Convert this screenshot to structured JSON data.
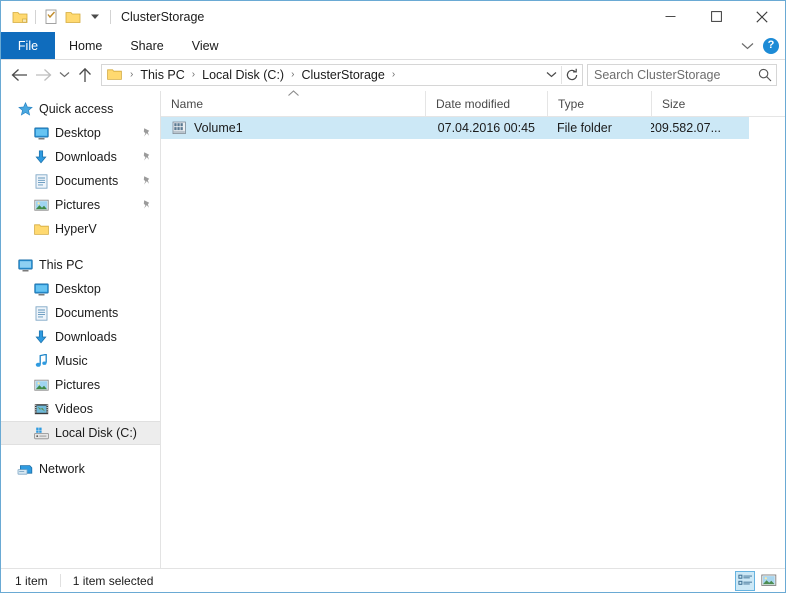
{
  "window": {
    "title": "ClusterStorage",
    "quick_access_toolbar": [
      {
        "name": "properties-folder-icon",
        "label": "Folder"
      },
      {
        "name": "properties-icon",
        "label": "Properties"
      },
      {
        "name": "new-folder-icon",
        "label": "New folder"
      },
      {
        "name": "customize-qat-chevron-icon",
        "label": "Customize Quick Access Toolbar"
      }
    ],
    "controls": {
      "minimize": "Minimize",
      "maximize": "Maximize",
      "close": "Close"
    }
  },
  "ribbon": {
    "tabs": [
      {
        "label": "File",
        "active": true
      },
      {
        "label": "Home",
        "active": false
      },
      {
        "label": "Share",
        "active": false
      },
      {
        "label": "View",
        "active": false
      }
    ],
    "expand_label": "Expand the Ribbon",
    "help_label": "?"
  },
  "address_bar": {
    "back": "Back",
    "forward": "Forward",
    "recent": "Recent locations",
    "up": "Up",
    "breadcrumbs": [
      "This PC",
      "Local Disk (C:)",
      "ClusterStorage"
    ],
    "separator": "›",
    "dropdown": "Previous locations",
    "refresh": "Refresh",
    "search_placeholder": "Search ClusterStorage",
    "search_value": ""
  },
  "sidebar": {
    "groups": [
      {
        "header": {
          "label": "Quick access",
          "icon": "quick-access-star-icon",
          "level": 0,
          "pinned": false
        },
        "items": [
          {
            "label": "Desktop",
            "icon": "desktop-icon",
            "level": 1,
            "pinned": true
          },
          {
            "label": "Downloads",
            "icon": "downloads-icon",
            "level": 1,
            "pinned": true
          },
          {
            "label": "Documents",
            "icon": "documents-icon",
            "level": 1,
            "pinned": true
          },
          {
            "label": "Pictures",
            "icon": "pictures-icon",
            "level": 1,
            "pinned": true
          },
          {
            "label": "HyperV",
            "icon": "folder-icon",
            "level": 1,
            "pinned": false
          }
        ]
      },
      {
        "header": {
          "label": "This PC",
          "icon": "this-pc-icon",
          "level": 0,
          "pinned": false
        },
        "items": [
          {
            "label": "Desktop",
            "icon": "desktop-icon",
            "level": 1,
            "pinned": false
          },
          {
            "label": "Documents",
            "icon": "documents-icon",
            "level": 1,
            "pinned": false
          },
          {
            "label": "Downloads",
            "icon": "downloads-icon",
            "level": 1,
            "pinned": false
          },
          {
            "label": "Music",
            "icon": "music-icon",
            "level": 1,
            "pinned": false
          },
          {
            "label": "Pictures",
            "icon": "pictures-icon",
            "level": 1,
            "pinned": false
          },
          {
            "label": "Videos",
            "icon": "videos-icon",
            "level": 1,
            "pinned": false
          },
          {
            "label": "Local Disk (C:)",
            "icon": "local-disk-icon",
            "level": 1,
            "pinned": false,
            "selected": true
          }
        ]
      },
      {
        "header": {
          "label": "Network",
          "icon": "network-icon",
          "level": 0,
          "pinned": false
        },
        "items": []
      }
    ]
  },
  "file_list": {
    "columns": [
      {
        "label": "Name",
        "sorted": "asc"
      },
      {
        "label": "Date modified",
        "sorted": ""
      },
      {
        "label": "Type",
        "sorted": ""
      },
      {
        "label": "Size",
        "sorted": ""
      }
    ],
    "rows": [
      {
        "name": "Volume1",
        "date_modified": "07.04.2016 00:45",
        "type": "File folder",
        "size": "209.582.07...",
        "icon": "mounted-volume-icon",
        "selected": true
      }
    ]
  },
  "status_bar": {
    "item_count": "1 item",
    "selection": "1 item selected",
    "views": [
      {
        "name": "details-view-button",
        "label": "Details view",
        "active": true
      },
      {
        "name": "large-icons-view-button",
        "label": "Large icons view",
        "active": false
      }
    ]
  },
  "colors": {
    "accent": "#0f6cbd",
    "selection": "#cce8f6",
    "nav_selection": "#ededed",
    "window_border": "#6aaad4",
    "folder_yellow": "#ffd970"
  }
}
